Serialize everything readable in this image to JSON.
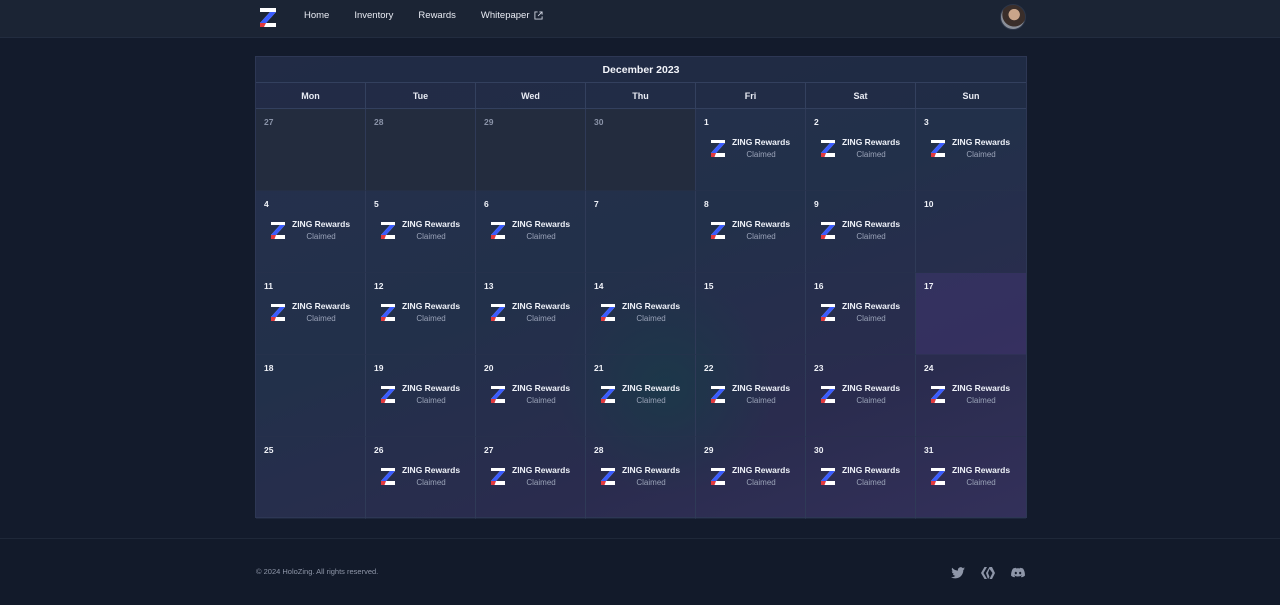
{
  "nav": {
    "items": [
      {
        "label": "Home"
      },
      {
        "label": "Inventory"
      },
      {
        "label": "Rewards"
      },
      {
        "label": "Whitepaper"
      }
    ]
  },
  "calendar": {
    "title": "December 2023",
    "weekdays": [
      "Mon",
      "Tue",
      "Wed",
      "Thu",
      "Fri",
      "Sat",
      "Sun"
    ],
    "reward_title": "ZING Rewards",
    "reward_status": "Claimed",
    "weeks": [
      [
        {
          "day": "27",
          "outside": true,
          "reward": false
        },
        {
          "day": "28",
          "outside": true,
          "reward": false
        },
        {
          "day": "29",
          "outside": true,
          "reward": false
        },
        {
          "day": "30",
          "outside": true,
          "reward": false
        },
        {
          "day": "1",
          "reward": true
        },
        {
          "day": "2",
          "reward": true
        },
        {
          "day": "3",
          "reward": true
        }
      ],
      [
        {
          "day": "4",
          "reward": true
        },
        {
          "day": "5",
          "reward": true
        },
        {
          "day": "6",
          "reward": true
        },
        {
          "day": "7",
          "reward": false
        },
        {
          "day": "8",
          "reward": true
        },
        {
          "day": "9",
          "reward": true
        },
        {
          "day": "10",
          "reward": false
        }
      ],
      [
        {
          "day": "11",
          "reward": true
        },
        {
          "day": "12",
          "reward": true
        },
        {
          "day": "13",
          "reward": true
        },
        {
          "day": "14",
          "reward": true
        },
        {
          "day": "15",
          "reward": false
        },
        {
          "day": "16",
          "reward": true
        },
        {
          "day": "17",
          "reward": false,
          "highlight": true
        }
      ],
      [
        {
          "day": "18",
          "reward": false
        },
        {
          "day": "19",
          "reward": true
        },
        {
          "day": "20",
          "reward": true
        },
        {
          "day": "21",
          "reward": true
        },
        {
          "day": "22",
          "reward": true
        },
        {
          "day": "23",
          "reward": true
        },
        {
          "day": "24",
          "reward": true
        }
      ],
      [
        {
          "day": "25",
          "reward": false
        },
        {
          "day": "26",
          "reward": true
        },
        {
          "day": "27",
          "reward": true
        },
        {
          "day": "28",
          "reward": true
        },
        {
          "day": "29",
          "reward": true
        },
        {
          "day": "30",
          "reward": true
        },
        {
          "day": "31",
          "reward": true
        }
      ]
    ]
  },
  "footer": {
    "copyright": "© 2024 HoloZing. All rights reserved.",
    "social": [
      "twitter-icon",
      "hive-icon",
      "discord-icon"
    ]
  },
  "colors": {
    "background": "#131b2c",
    "brand_blue": "#3a5cff",
    "brand_red": "#e0393e"
  }
}
